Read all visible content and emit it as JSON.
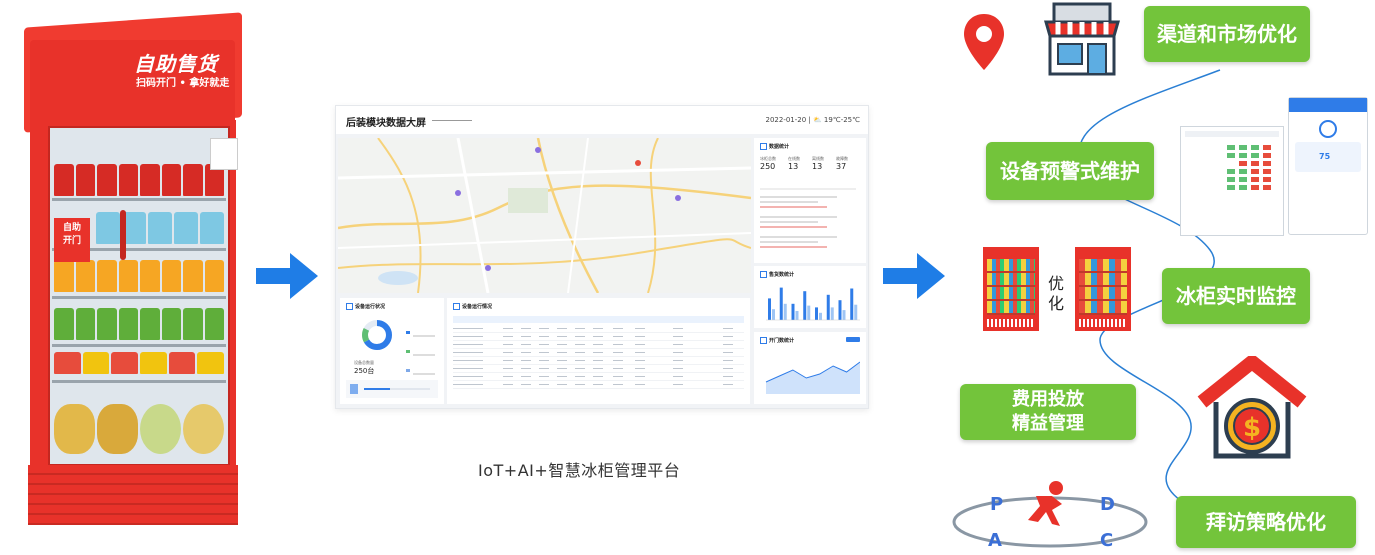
{
  "fridge": {
    "brand_title": "自助售货",
    "brand_slogan": "扫码开门 • 拿好就走",
    "door_sticker": "自助\n开门"
  },
  "dashboard": {
    "title": "后装模块数据大屏",
    "date_weather": "2022-01-20  |  ⛅ 19℃-25℃",
    "stats_title": "数据统计",
    "stats": [
      {
        "label": "冰柜总数",
        "value": "250"
      },
      {
        "label": "在线数",
        "value": "13"
      },
      {
        "label": "离线数",
        "value": "13"
      },
      {
        "label": "故障数",
        "value": "37"
      }
    ],
    "device_status_title": "设备运行状况",
    "device_list_title": "设备运行情况",
    "device_count_label": "设备总数量",
    "device_count_value": "250台",
    "sales_title": "售货数统计",
    "open_title": "开门数统计"
  },
  "caption": "IoT+AI+智慧冰柜管理平台",
  "features": {
    "channel": "渠道和市场优化",
    "warning": "设备预警式维护",
    "monitor": "冰柜实时监控",
    "cost_line1": "费用投放",
    "cost_line2": "精益管理",
    "visit": "拜访策略优化",
    "optimize_text": "优\n化",
    "pdca": [
      "P",
      "D",
      "A",
      "C"
    ]
  },
  "colors": {
    "accent_green": "#73c43b",
    "arrow_blue": "#1f7de6",
    "fridge_red": "#e8322a"
  },
  "icons": [
    "location-pin-icon",
    "store-icon",
    "house-dollar-icon",
    "runner-icon"
  ],
  "chart_data": [
    {
      "type": "bar",
      "title": "售货数统计",
      "categories": [
        "",
        "",
        "",
        "",
        "",
        "",
        "",
        ""
      ],
      "series": [
        {
          "name": "",
          "values": [
            120,
            180,
            90,
            160,
            70,
            140,
            110,
            175
          ]
        },
        {
          "name": "",
          "values": [
            60,
            90,
            50,
            80,
            40,
            70,
            55,
            85
          ]
        }
      ],
      "ylim": [
        0,
        200
      ]
    },
    {
      "type": "area",
      "title": "开门数统计",
      "categories": [
        "",
        "",
        "",
        "",
        "",
        "",
        "",
        ""
      ],
      "values": [
        60,
        90,
        120,
        80,
        100,
        140,
        110,
        160
      ],
      "ylim": [
        0,
        200
      ]
    }
  ]
}
